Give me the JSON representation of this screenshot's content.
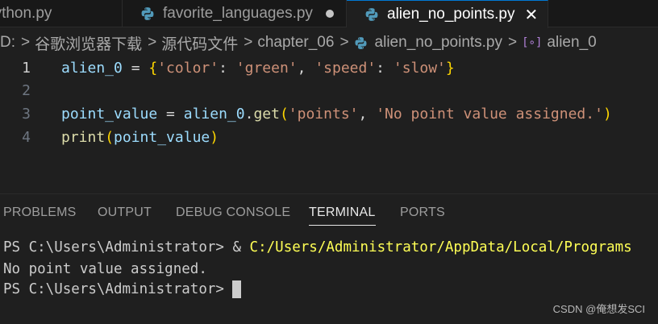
{
  "tabs": [
    {
      "label": "python.py",
      "active": false
    },
    {
      "label": "favorite_languages.py",
      "active": false,
      "modified": true
    },
    {
      "label": "alien_no_points.py",
      "active": true
    }
  ],
  "tab_close_glyph": "✕",
  "breadcrumb": {
    "items": [
      "D:",
      "谷歌浏览器下载",
      "源代码文件",
      "chapter_06",
      "alien_no_points.py"
    ],
    "separator": ">",
    "symbol_glyph": "[∘]",
    "symbol": "alien_0"
  },
  "editor": {
    "lines": [
      {
        "num": "1",
        "tokens": [
          [
            "alien_0",
            "v"
          ],
          [
            " = ",
            "op"
          ],
          [
            "{",
            "b1"
          ],
          [
            "'color'",
            "s"
          ],
          [
            ": ",
            "p"
          ],
          [
            "'green'",
            "s"
          ],
          [
            ", ",
            "p"
          ],
          [
            "'speed'",
            "s"
          ],
          [
            ": ",
            "p"
          ],
          [
            "'slow'",
            "s"
          ],
          [
            "}",
            "b1"
          ]
        ]
      },
      {
        "num": "2",
        "tokens": []
      },
      {
        "num": "3",
        "tokens": [
          [
            "point_value",
            "v"
          ],
          [
            " = ",
            "op"
          ],
          [
            "alien_0",
            "v"
          ],
          [
            ".",
            "p"
          ],
          [
            "get",
            "fn"
          ],
          [
            "(",
            "b1"
          ],
          [
            "'points'",
            "s"
          ],
          [
            ", ",
            "p"
          ],
          [
            "'No point value assigned.'",
            "s"
          ],
          [
            ")",
            "b1"
          ]
        ]
      },
      {
        "num": "4",
        "tokens": [
          [
            "print",
            "fn"
          ],
          [
            "(",
            "b1"
          ],
          [
            "point_value",
            "v"
          ],
          [
            ")",
            "b1"
          ]
        ]
      }
    ]
  },
  "panel": {
    "tabs": [
      "PROBLEMS",
      "OUTPUT",
      "DEBUG CONSOLE",
      "TERMINAL",
      "PORTS"
    ],
    "active_tab": "TERMINAL"
  },
  "terminal": {
    "line1_prompt": "PS C:\\Users\\Administrator> & ",
    "line1_cmd": "C:/Users/Administrator/AppData/Local/Programs",
    "line2": "No point value assigned.",
    "line3_prompt": "PS C:\\Users\\Administrator>"
  },
  "watermark": "CSDN @俺想发SCI",
  "colors": {
    "accent": "#0078d4",
    "variable": "#9cdcfe",
    "string": "#ce9178",
    "function": "#dcdcaa",
    "bracket": "#ffd700",
    "terminal_command": "#ffff55"
  }
}
